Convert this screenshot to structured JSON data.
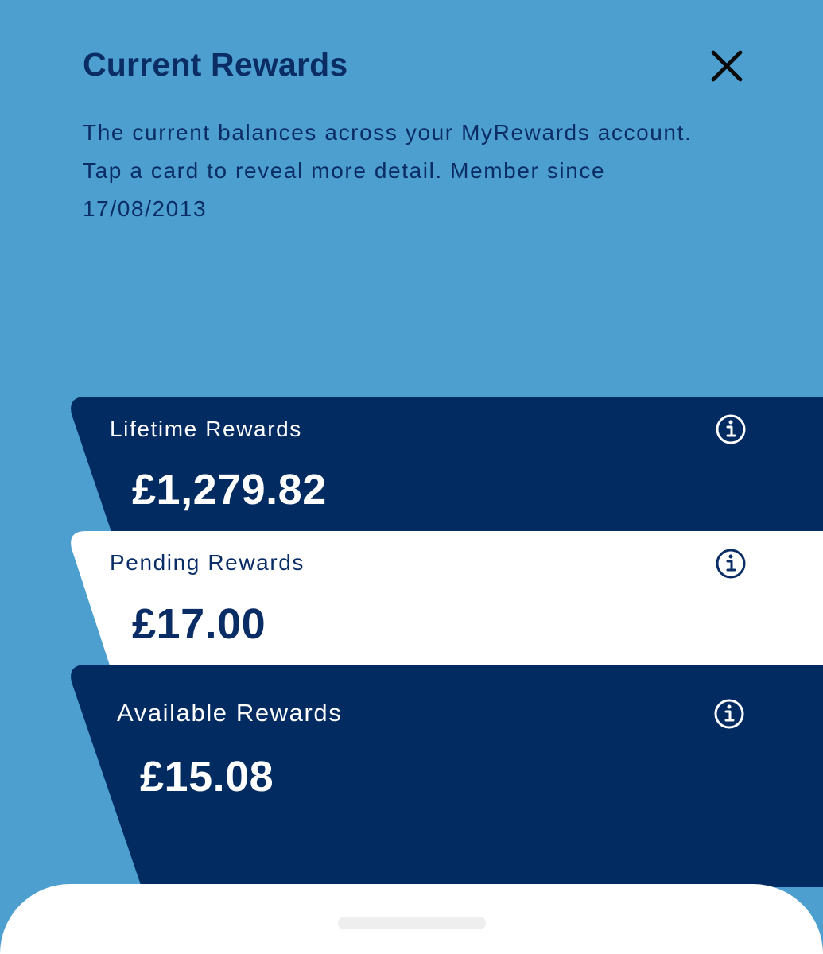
{
  "header": {
    "title": "Current Rewards",
    "close_icon": "close-icon"
  },
  "description": {
    "line1": "The current balances across your MyRewards account.",
    "line2": "Tap a card to reveal more detail. Member since",
    "line3": "17/08/2013"
  },
  "cards": [
    {
      "label": "Lifetime Rewards",
      "amount": "£1,279.82",
      "icon": "info-icon",
      "background": "#022b62",
      "text_color": "#ffffff"
    },
    {
      "label": "Pending Rewards",
      "amount": "£17.00",
      "icon": "info-icon",
      "background": "#ffffff",
      "text_color": "#0b2d66"
    },
    {
      "label": "Available Rewards",
      "amount": "£15.08",
      "icon": "info-icon",
      "background": "#022b62",
      "text_color": "#ffffff"
    }
  ],
  "colors": {
    "page_background": "#4d9fd0",
    "navy": "#022b62",
    "white": "#ffffff"
  }
}
